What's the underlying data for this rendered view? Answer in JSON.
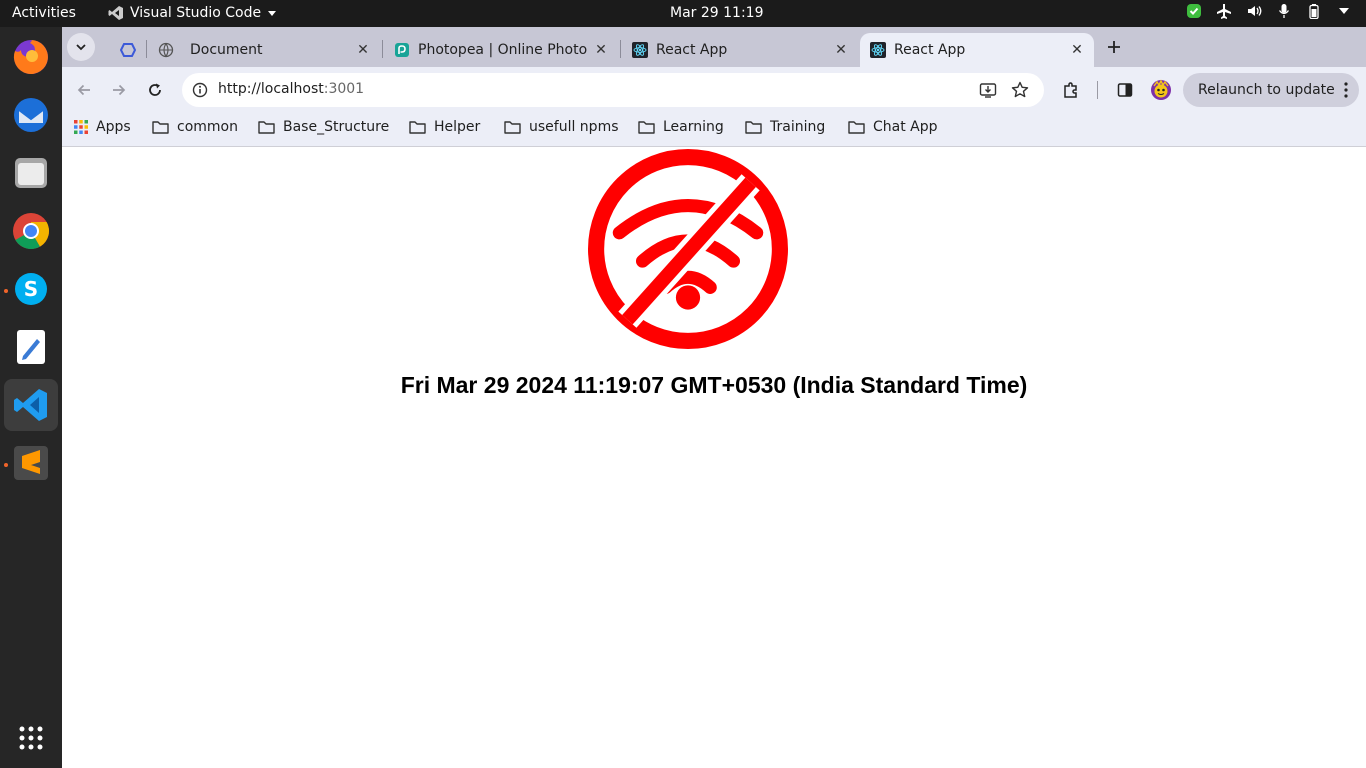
{
  "topbar": {
    "activities": "Activities",
    "app_name": "Visual Studio Code",
    "clock": "Mar 29  11:19"
  },
  "dock": {
    "apps": [
      "firefox-icon",
      "thunderbird-icon",
      "files-icon",
      "chrome-icon",
      "skype-icon",
      "text-editor-icon",
      "vscode-icon",
      "sublime-text-icon",
      "show-apps-icon"
    ]
  },
  "tabs": [
    {
      "title": "Document"
    },
    {
      "title": "Photopea | Online Photo Editor"
    },
    {
      "title": "React App"
    },
    {
      "title": "React App"
    }
  ],
  "toolbar": {
    "url_host": "http://localhost",
    "url_port": ":3001",
    "relaunch_label": "Relaunch to update"
  },
  "bookmarks": [
    "Apps",
    "common",
    "Base_Structure",
    "Helper",
    "usefull npms",
    "Learning",
    "Training",
    "Chat App"
  ],
  "page": {
    "date_text": "Fri Mar 29 2024 11:19:07 GMT+0530 (India Standard Time)"
  },
  "colors": {
    "offline_red": "#ff0000",
    "tabstrip": "#c7c7d5",
    "toolbar": "#eceef7"
  }
}
